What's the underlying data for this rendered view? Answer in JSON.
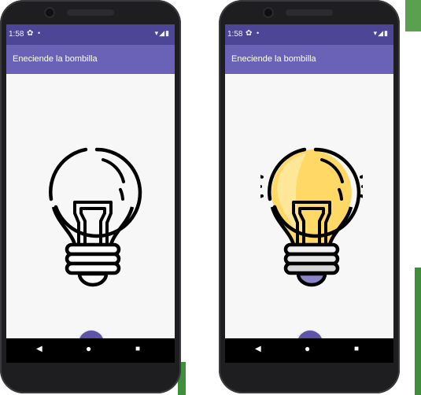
{
  "phones": [
    {
      "state": "off",
      "status_bar": {
        "time": "1:58",
        "settings_icon": "gear-icon",
        "icons_text": "▾◢▮"
      },
      "appbar": {
        "title": "Eneciende la bombilla"
      },
      "fab": {
        "icon": "power-icon",
        "glyph": "❄"
      },
      "nav": {
        "back": "◀",
        "home": "●",
        "recent": "■"
      }
    },
    {
      "state": "on",
      "status_bar": {
        "time": "1:58",
        "settings_icon": "gear-icon",
        "icons_text": "▾◢▮"
      },
      "appbar": {
        "title": "Eneciende la bombilla"
      },
      "fab": {
        "icon": "power-icon",
        "glyph": "❄"
      },
      "nav": {
        "back": "◀",
        "home": "●",
        "recent": "■"
      }
    }
  ],
  "colors": {
    "status_bar": "#4d4696",
    "app_bar": "#6a62b6",
    "fab": "#5e55a9",
    "bulb_on_fill": "#ffd866",
    "bulb_on_highlight": "#ffe79a",
    "bulb_off_fill": "#ffffff",
    "screen_bg": "#f7f7f8"
  }
}
